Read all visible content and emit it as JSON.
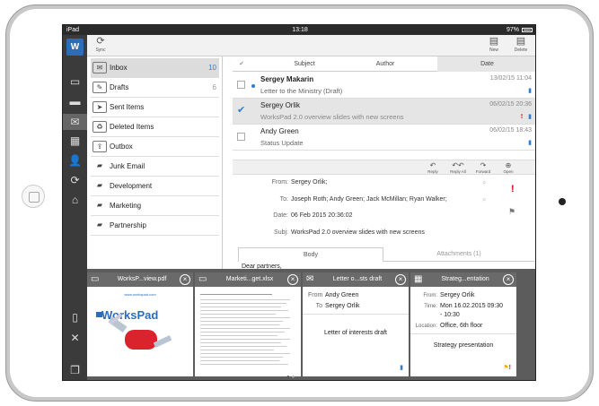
{
  "status_bar": {
    "device": "iPad",
    "time": "13:18",
    "battery": "97%"
  },
  "toolbar": {
    "sync_label": "Sync",
    "new_label": "New",
    "delete_label": "Delete"
  },
  "folders": [
    {
      "label": "Inbox",
      "count": "10"
    },
    {
      "label": "Drafts",
      "count": "6"
    },
    {
      "label": "Sent Items",
      "count": ""
    },
    {
      "label": "Deleted Items",
      "count": ""
    },
    {
      "label": "Outbox",
      "count": ""
    },
    {
      "label": "Junk Email",
      "count": ""
    },
    {
      "label": "Development",
      "count": ""
    },
    {
      "label": "Marketing",
      "count": ""
    },
    {
      "label": "Partnership",
      "count": ""
    }
  ],
  "list_header": {
    "subject": "Subject",
    "author": "Author",
    "date": "Date"
  },
  "messages": [
    {
      "sender": "Sergey Makarin",
      "subject": "Letter to the Ministry (Draft)",
      "date": "13/02/15 11:04"
    },
    {
      "sender": "Sergey Orlik",
      "subject": "WorksPad 2.0 overview slides with new screens",
      "date": "06/02/15 20:36"
    },
    {
      "sender": "Andy Green",
      "subject": "Status Update",
      "date": "06/02/15 18:43"
    }
  ],
  "message_actions": {
    "reply": "Reply",
    "reply_all": "Reply All",
    "forward": "Forward",
    "open": "Open"
  },
  "message_header": {
    "from_label": "From:",
    "from": "Sergey Orlik;",
    "to_label": "To:",
    "to": "Joseph Roth;  Andy Green;  Jack McMillan;  Ryan Walker;",
    "date_label": "Date:",
    "date": "06 Feb 2015 20:36:02",
    "subject_label": "Subj:",
    "subject": "WorksPad 2.0 overview slides with new screens"
  },
  "message_tabs": {
    "body": "Body",
    "attachments": "Attachments (1)"
  },
  "message_body": "Dear partners,",
  "tray": {
    "cards": [
      {
        "title": "WorksP...view.pdf"
      },
      {
        "title": "Marketi...get.xlsx"
      },
      {
        "title": "Letter o...sts draft"
      },
      {
        "title": "Strateg...entation"
      }
    ],
    "pdf": {
      "url": "www.workspad.com",
      "logo": "WorksPad"
    },
    "letter": {
      "from_label": "From",
      "from": "Andy Green",
      "to_label": "To",
      "to": "Sergey Orlik",
      "body": "Letter of interests draft"
    },
    "event": {
      "from_label": "From:",
      "from": "Sergey Orlik",
      "time_label": "Time:",
      "time_line1": "Mon 16.02.2015 09:30",
      "time_line2": "- 10:30",
      "location_label": "Location:",
      "location": "Office, 6th floor",
      "title": "Strategy presentation"
    }
  },
  "colors": {
    "accent": "#2d7dd2",
    "sidebar": "#3b3b3b",
    "flag_red": "#e0001b"
  }
}
